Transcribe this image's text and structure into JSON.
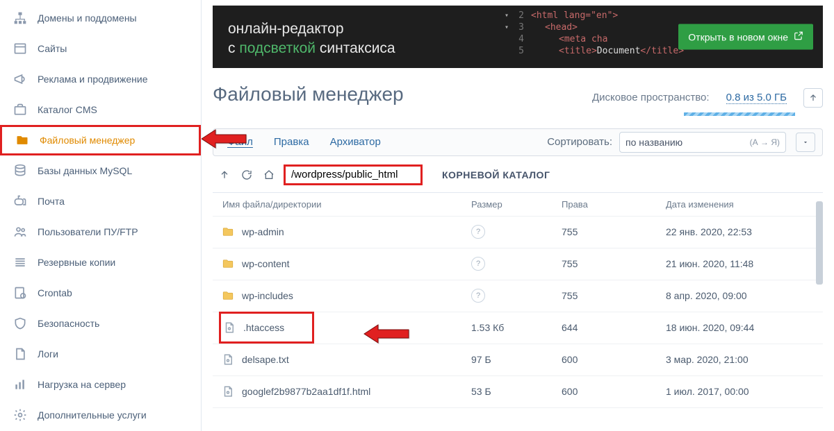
{
  "sidebar": {
    "items": [
      {
        "label": "Домены и поддомены",
        "icon": "sitemap"
      },
      {
        "label": "Сайты",
        "icon": "browser"
      },
      {
        "label": "Реклама и продвижение",
        "icon": "megaphone"
      },
      {
        "label": "Каталог CMS",
        "icon": "briefcase"
      },
      {
        "label": "Файловый менеджер",
        "icon": "folder",
        "active": true
      },
      {
        "label": "Базы данных MySQL",
        "icon": "database"
      },
      {
        "label": "Почта",
        "icon": "mailbox"
      },
      {
        "label": "Пользователи ПУ/FTP",
        "icon": "users"
      },
      {
        "label": "Резервные копии",
        "icon": "stack"
      },
      {
        "label": "Crontab",
        "icon": "gearpage"
      },
      {
        "label": "Безопасность",
        "icon": "shield"
      },
      {
        "label": "Логи",
        "icon": "doc"
      },
      {
        "label": "Нагрузка на сервер",
        "icon": "barchart"
      },
      {
        "label": "Дополнительные услуги",
        "icon": "gear"
      }
    ]
  },
  "banner": {
    "line1": "онлайн-редактор",
    "line2_pre": "с ",
    "line2_hl": "подсветкой",
    "line2_post": " синтаксиса",
    "button": "Открыть в новом окне",
    "code": {
      "l2": "<html lang=\"en\">",
      "l3": "<head>",
      "l4": "<meta cha",
      "l5a": "<title>",
      "l5b": "Document",
      "l5c": "</title>"
    }
  },
  "page": {
    "title": "Файловый менеджер",
    "disk_label": "Дисковое пространство:",
    "disk_value": "0.8 из 5.0 ГБ"
  },
  "toolbar": {
    "file": "Файл",
    "edit": "Правка",
    "arch": "Архиватор",
    "sort_label": "Сортировать:",
    "sort_value": "по названию",
    "sort_dir": "(А → Я)"
  },
  "path": {
    "value": "/wordpress/public_html",
    "root_label": "КОРНЕВОЙ КАТАЛОГ"
  },
  "columns": {
    "name": "Имя файла/директории",
    "size": "Размер",
    "perm": "Права",
    "date": "Дата изменения"
  },
  "rows": [
    {
      "type": "folder",
      "name": "wp-admin",
      "size": "?",
      "perm": "755",
      "date": "22 янв. 2020, 22:53"
    },
    {
      "type": "folder",
      "name": "wp-content",
      "size": "?",
      "perm": "755",
      "date": "21 июн. 2020, 11:48"
    },
    {
      "type": "folder",
      "name": "wp-includes",
      "size": "?",
      "perm": "755",
      "date": "8 апр. 2020, 09:00"
    },
    {
      "type": "file",
      "name": ".htaccess",
      "size": "1.53 Кб",
      "perm": "644",
      "date": "18 июн. 2020, 09:44",
      "boxed": true
    },
    {
      "type": "file",
      "name": "delsape.txt",
      "size": "97 Б",
      "perm": "600",
      "date": "3 мар. 2020, 21:00"
    },
    {
      "type": "file",
      "name": "googlef2b9877b2aa1df1f.html",
      "size": "53 Б",
      "perm": "600",
      "date": "1 июл. 2017, 00:00"
    }
  ]
}
